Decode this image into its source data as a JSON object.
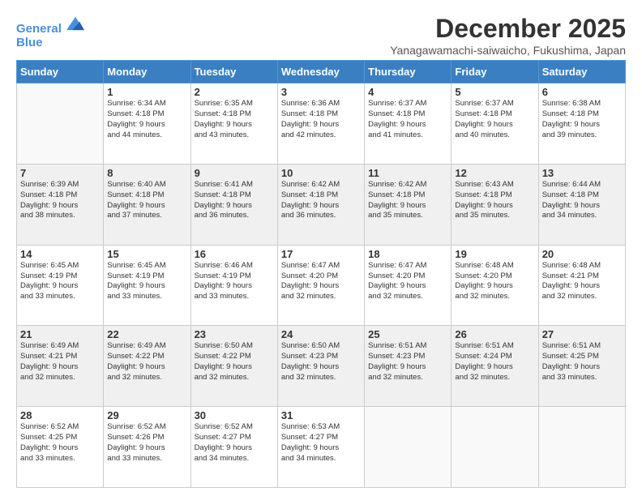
{
  "logo": {
    "line1": "General",
    "line2": "Blue"
  },
  "title": "December 2025",
  "subtitle": "Yanagawamachi-saiwaicho, Fukushima, Japan",
  "weekdays": [
    "Sunday",
    "Monday",
    "Tuesday",
    "Wednesday",
    "Thursday",
    "Friday",
    "Saturday"
  ],
  "weeks": [
    [
      {
        "day": "",
        "sunrise": "",
        "sunset": "",
        "daylight": ""
      },
      {
        "day": "1",
        "sunrise": "6:34 AM",
        "sunset": "4:18 PM",
        "daylight": "9 hours and 44 minutes."
      },
      {
        "day": "2",
        "sunrise": "6:35 AM",
        "sunset": "4:18 PM",
        "daylight": "9 hours and 43 minutes."
      },
      {
        "day": "3",
        "sunrise": "6:36 AM",
        "sunset": "4:18 PM",
        "daylight": "9 hours and 42 minutes."
      },
      {
        "day": "4",
        "sunrise": "6:37 AM",
        "sunset": "4:18 PM",
        "daylight": "9 hours and 41 minutes."
      },
      {
        "day": "5",
        "sunrise": "6:37 AM",
        "sunset": "4:18 PM",
        "daylight": "9 hours and 40 minutes."
      },
      {
        "day": "6",
        "sunrise": "6:38 AM",
        "sunset": "4:18 PM",
        "daylight": "9 hours and 39 minutes."
      }
    ],
    [
      {
        "day": "7",
        "sunrise": "6:39 AM",
        "sunset": "4:18 PM",
        "daylight": "9 hours and 38 minutes."
      },
      {
        "day": "8",
        "sunrise": "6:40 AM",
        "sunset": "4:18 PM",
        "daylight": "9 hours and 37 minutes."
      },
      {
        "day": "9",
        "sunrise": "6:41 AM",
        "sunset": "4:18 PM",
        "daylight": "9 hours and 36 minutes."
      },
      {
        "day": "10",
        "sunrise": "6:42 AM",
        "sunset": "4:18 PM",
        "daylight": "9 hours and 36 minutes."
      },
      {
        "day": "11",
        "sunrise": "6:42 AM",
        "sunset": "4:18 PM",
        "daylight": "9 hours and 35 minutes."
      },
      {
        "day": "12",
        "sunrise": "6:43 AM",
        "sunset": "4:18 PM",
        "daylight": "9 hours and 35 minutes."
      },
      {
        "day": "13",
        "sunrise": "6:44 AM",
        "sunset": "4:18 PM",
        "daylight": "9 hours and 34 minutes."
      }
    ],
    [
      {
        "day": "14",
        "sunrise": "6:45 AM",
        "sunset": "4:19 PM",
        "daylight": "9 hours and 33 minutes."
      },
      {
        "day": "15",
        "sunrise": "6:45 AM",
        "sunset": "4:19 PM",
        "daylight": "9 hours and 33 minutes."
      },
      {
        "day": "16",
        "sunrise": "6:46 AM",
        "sunset": "4:19 PM",
        "daylight": "9 hours and 33 minutes."
      },
      {
        "day": "17",
        "sunrise": "6:47 AM",
        "sunset": "4:20 PM",
        "daylight": "9 hours and 32 minutes."
      },
      {
        "day": "18",
        "sunrise": "6:47 AM",
        "sunset": "4:20 PM",
        "daylight": "9 hours and 32 minutes."
      },
      {
        "day": "19",
        "sunrise": "6:48 AM",
        "sunset": "4:20 PM",
        "daylight": "9 hours and 32 minutes."
      },
      {
        "day": "20",
        "sunrise": "6:48 AM",
        "sunset": "4:21 PM",
        "daylight": "9 hours and 32 minutes."
      }
    ],
    [
      {
        "day": "21",
        "sunrise": "6:49 AM",
        "sunset": "4:21 PM",
        "daylight": "9 hours and 32 minutes."
      },
      {
        "day": "22",
        "sunrise": "6:49 AM",
        "sunset": "4:22 PM",
        "daylight": "9 hours and 32 minutes."
      },
      {
        "day": "23",
        "sunrise": "6:50 AM",
        "sunset": "4:22 PM",
        "daylight": "9 hours and 32 minutes."
      },
      {
        "day": "24",
        "sunrise": "6:50 AM",
        "sunset": "4:23 PM",
        "daylight": "9 hours and 32 minutes."
      },
      {
        "day": "25",
        "sunrise": "6:51 AM",
        "sunset": "4:23 PM",
        "daylight": "9 hours and 32 minutes."
      },
      {
        "day": "26",
        "sunrise": "6:51 AM",
        "sunset": "4:24 PM",
        "daylight": "9 hours and 32 minutes."
      },
      {
        "day": "27",
        "sunrise": "6:51 AM",
        "sunset": "4:25 PM",
        "daylight": "9 hours and 33 minutes."
      }
    ],
    [
      {
        "day": "28",
        "sunrise": "6:52 AM",
        "sunset": "4:25 PM",
        "daylight": "9 hours and 33 minutes."
      },
      {
        "day": "29",
        "sunrise": "6:52 AM",
        "sunset": "4:26 PM",
        "daylight": "9 hours and 33 minutes."
      },
      {
        "day": "30",
        "sunrise": "6:52 AM",
        "sunset": "4:27 PM",
        "daylight": "9 hours and 34 minutes."
      },
      {
        "day": "31",
        "sunrise": "6:53 AM",
        "sunset": "4:27 PM",
        "daylight": "9 hours and 34 minutes."
      },
      {
        "day": "",
        "sunrise": "",
        "sunset": "",
        "daylight": ""
      },
      {
        "day": "",
        "sunrise": "",
        "sunset": "",
        "daylight": ""
      },
      {
        "day": "",
        "sunrise": "",
        "sunset": "",
        "daylight": ""
      }
    ]
  ]
}
